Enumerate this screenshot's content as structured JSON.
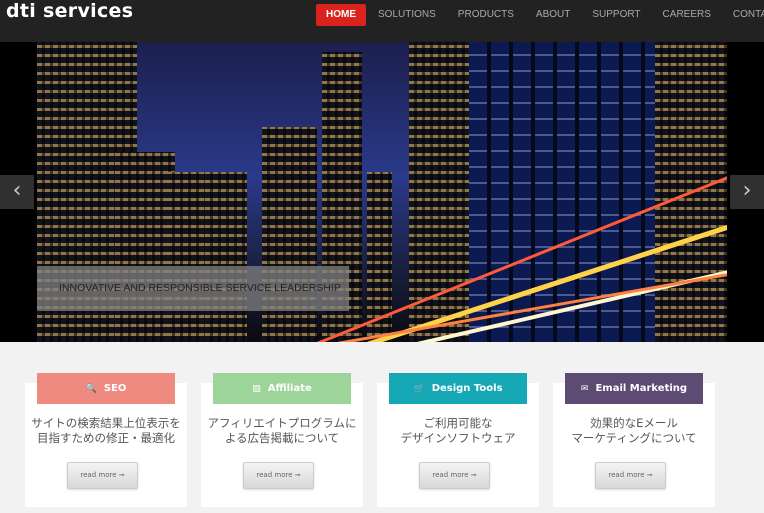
{
  "header": {
    "logo": "dti services",
    "nav": [
      {
        "label": "HOME",
        "active": true
      },
      {
        "label": "SOLUTIONS"
      },
      {
        "label": "PRODUCTS"
      },
      {
        "label": "ABOUT"
      },
      {
        "label": "SUPPORT"
      },
      {
        "label": "CAREERS"
      },
      {
        "label": "CONTACT"
      }
    ]
  },
  "slider": {
    "caption": "INNOVATIVE AND RESPONSIBLE SERVICE LEADERSHIP",
    "prev": "‹",
    "next": "›"
  },
  "features": [
    {
      "title": "SEO",
      "icon": "search-icon",
      "glyph": "🔍",
      "color": "#ef8a80",
      "line1": "サイトの検索結果上位表示を",
      "line2": "目指すための修正・最適化",
      "button": "read more ➞"
    },
    {
      "title": "Affiliate",
      "icon": "image-icon",
      "glyph": "▨",
      "color": "#9dd49a",
      "line1": "アフィリエイトプログラムに",
      "line2": "よる広告掲載について",
      "button": "read more ➞"
    },
    {
      "title": "Design Tools",
      "icon": "cart-icon",
      "glyph": "🛒",
      "color": "#16a8b5",
      "line1": "ご利用可能な",
      "line2": "デザインソフトウェア",
      "button": "read more ➞"
    },
    {
      "title": "Email Marketing",
      "icon": "envelope-icon",
      "glyph": "✉",
      "color": "#5e4b73",
      "line1": "効果的なEメール",
      "line2": "マーケティングについて",
      "button": "read more ➞"
    }
  ]
}
